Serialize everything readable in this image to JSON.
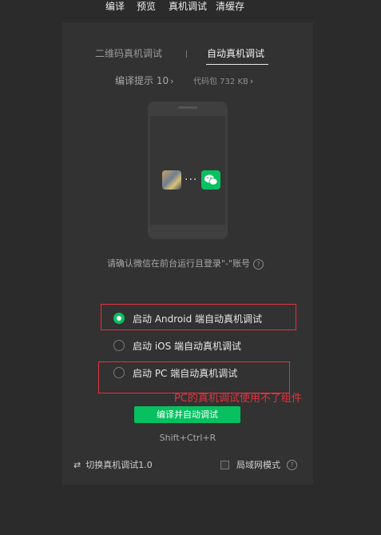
{
  "menubar": {
    "items": [
      "编译",
      "预览",
      "真机调试",
      "清缓存"
    ]
  },
  "tabs": [
    {
      "label": "二维码真机调试"
    },
    {
      "label": "自动真机调试"
    }
  ],
  "info": {
    "compile_hint": "编译提示 10",
    "package_size": "代码包 732 KB",
    "chevron": "›"
  },
  "phone": {
    "dots": "···"
  },
  "confirm_text": "请确认微信在前台运行且登录\"-\"账号",
  "help_glyph": "?",
  "options": [
    {
      "label": "启动 Android 端自动真机调试",
      "selected": true
    },
    {
      "label": "启动 iOS 端自动真机调试",
      "selected": false
    },
    {
      "label": "启动 PC 端自动真机调试",
      "selected": false
    }
  ],
  "annotation": {
    "text": "PC的真机调试使用不了组件",
    "color": "#e0333f"
  },
  "primary_button": "编译并自动调试",
  "shortcut": "Shift+Ctrl+R",
  "footer": {
    "switch_label": "切换真机调试1.0",
    "lan_label": "局域网模式"
  },
  "colors": {
    "accent": "#07c160",
    "background": "#2b2b2b",
    "panel": "#323232"
  }
}
